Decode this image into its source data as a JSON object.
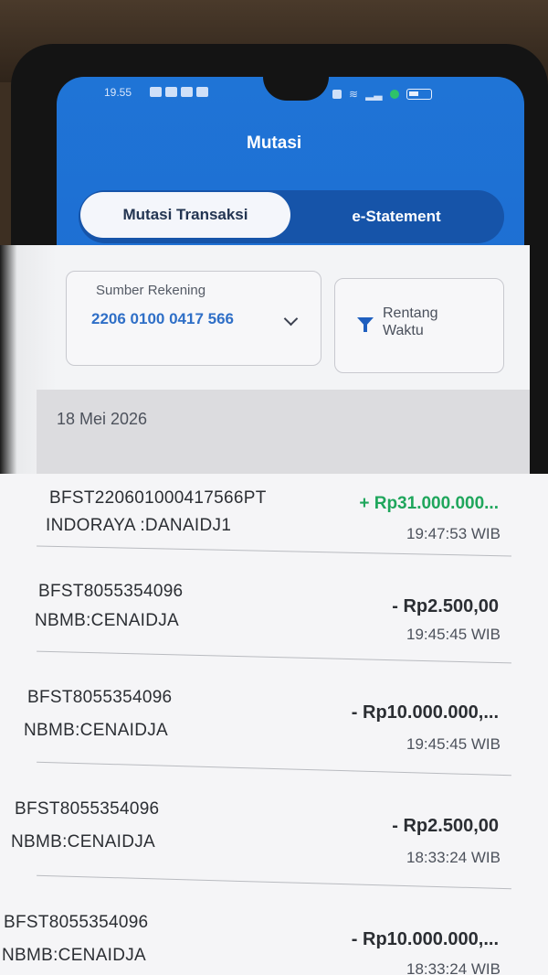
{
  "status_bar": {
    "time": "19.55"
  },
  "header": {
    "title": "Mutasi"
  },
  "tabs": [
    {
      "label": "Mutasi Transaksi",
      "active": true
    },
    {
      "label": "e-Statement",
      "active": false
    }
  ],
  "account": {
    "label": "Sumber Rekening",
    "value": "2206 0100 0417 566"
  },
  "range_filter": {
    "label": "Rentang Waktu"
  },
  "date_group": "18 Mei 2026",
  "transactions": [
    {
      "ref": "BFST220601000417566PT",
      "desc": "INDORAYA :DANAIDJ1",
      "amount": "+ Rp31.000.000...",
      "time": "19:47:53 WIB",
      "type": "credit"
    },
    {
      "ref": "BFST8055354096",
      "desc": "NBMB:CENAIDJA",
      "amount": "- Rp2.500,00",
      "time": "19:45:45 WIB",
      "type": "debit"
    },
    {
      "ref": "BFST8055354096",
      "desc": "NBMB:CENAIDJA",
      "amount": "- Rp10.000.000,...",
      "time": "19:45:45 WIB",
      "type": "debit"
    },
    {
      "ref": "BFST8055354096",
      "desc": "NBMB:CENAIDJA",
      "amount": "- Rp2.500,00",
      "time": "18:33:24 WIB",
      "type": "debit"
    },
    {
      "ref": "BFST8055354096",
      "desc": "NBMB:CENAIDJA",
      "amount": "- Rp10.000.000,...",
      "time": "18:33:24 WIB",
      "type": "debit"
    }
  ],
  "colors": {
    "primary": "#1f74d6",
    "credit": "#1fa65c",
    "tab_bg": "#1654a9"
  }
}
